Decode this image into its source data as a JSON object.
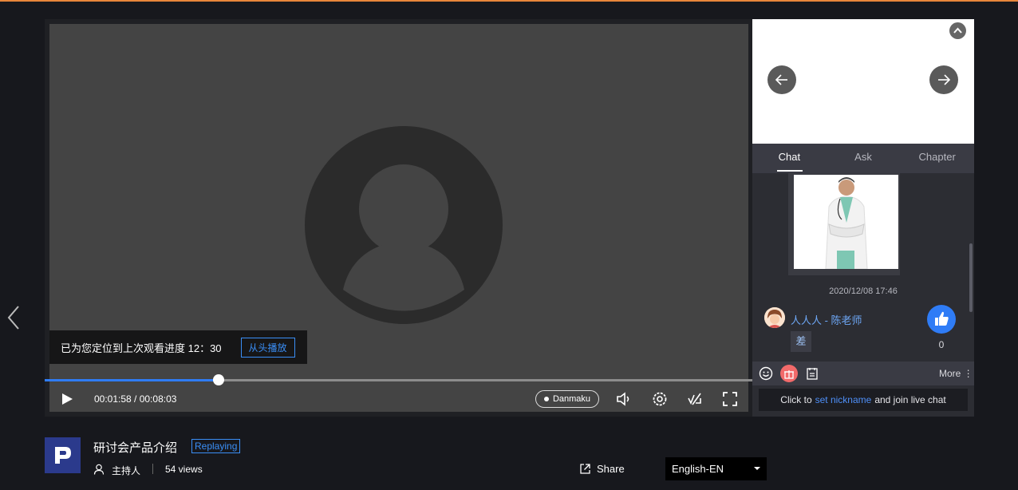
{
  "player": {
    "current_time": "00:01:58",
    "duration": "00:08:03",
    "time_display": "00:01:58 / 00:08:03",
    "progress": 0.246,
    "danmaku_label": "Danmaku",
    "resume_text": "已为您定位到上次观看进度 12：30",
    "replay_label": "从头播放"
  },
  "side": {
    "tabs": [
      {
        "label": "Chat",
        "active": true
      },
      {
        "label": "Ask",
        "active": false
      },
      {
        "label": "Chapter",
        "active": false
      }
    ],
    "chat": {
      "timestamp": "2020/12/08 17:46",
      "user": "人人人 - 陈老师",
      "message": "差",
      "like_count": "0"
    },
    "more_label": "More",
    "input": {
      "prefix": "Click to",
      "link": "set nickname",
      "suffix": "and join live chat"
    }
  },
  "info": {
    "title": "研讨会产品介绍",
    "badge": "Replaying",
    "host": "主持人",
    "views": "54 views",
    "share_label": "Share",
    "language": "English-EN"
  },
  "colors": {
    "accent": "#2f7cf6",
    "top_border": "#e8863a",
    "background": "#17181d"
  },
  "icons": [
    "chevron-left-icon",
    "play-icon",
    "volume-icon",
    "settings-icon",
    "line-switch-icon",
    "fullscreen-icon",
    "arrow-left-icon",
    "arrow-right-icon",
    "chevron-up-icon",
    "thumbs-up-icon",
    "emoji-icon",
    "gift-icon",
    "notes-icon",
    "user-icon",
    "share-icon",
    "caret-down-icon"
  ]
}
